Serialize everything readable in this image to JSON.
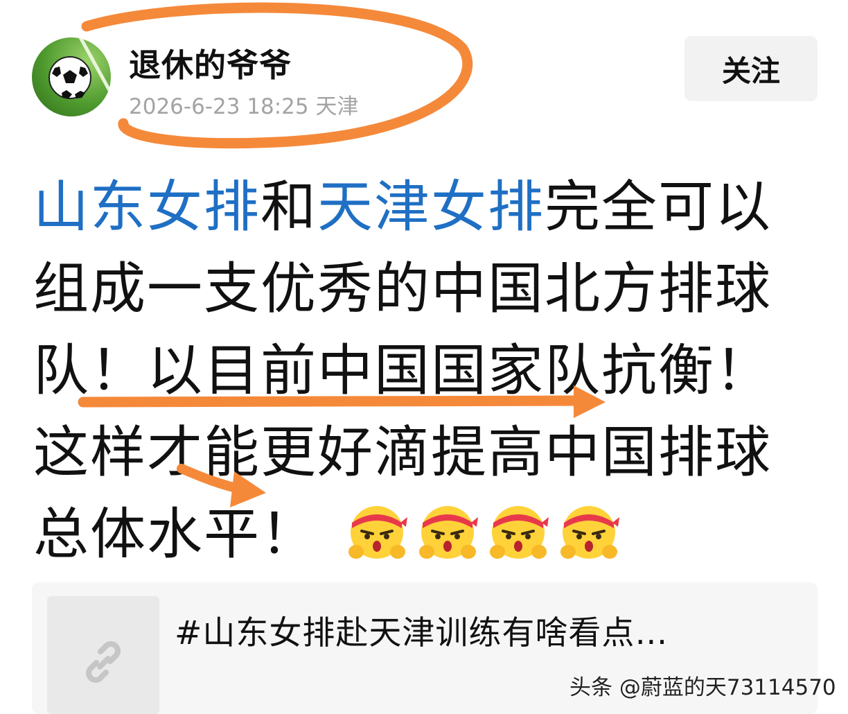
{
  "author": {
    "name": "退休的爷爷",
    "date_location": "2026-6-23 18:25 天津",
    "avatar_icon": "soccer-ball-icon"
  },
  "follow": {
    "label": "关注"
  },
  "post": {
    "topic_a": "山东女排",
    "connector": "和",
    "topic_b": "天津女排",
    "body_text": "完全可以组成一支优秀的中国北方排球队！以目前中国国家队抗衡！这样才能更好滴提高中国排球总体水平！",
    "emoji_icon": "headband-cheering-face-icon",
    "emoji_count": 4
  },
  "link_card": {
    "title": "#山东女排赴天津训练有啥看点…",
    "icon": "link-icon"
  },
  "watermark": {
    "text": "头条 @蔚蓝的天73114570"
  },
  "colors": {
    "link": "#1f6fc4",
    "annotation": "#f5893a",
    "text": "#111111",
    "meta": "#a3a3a3"
  }
}
